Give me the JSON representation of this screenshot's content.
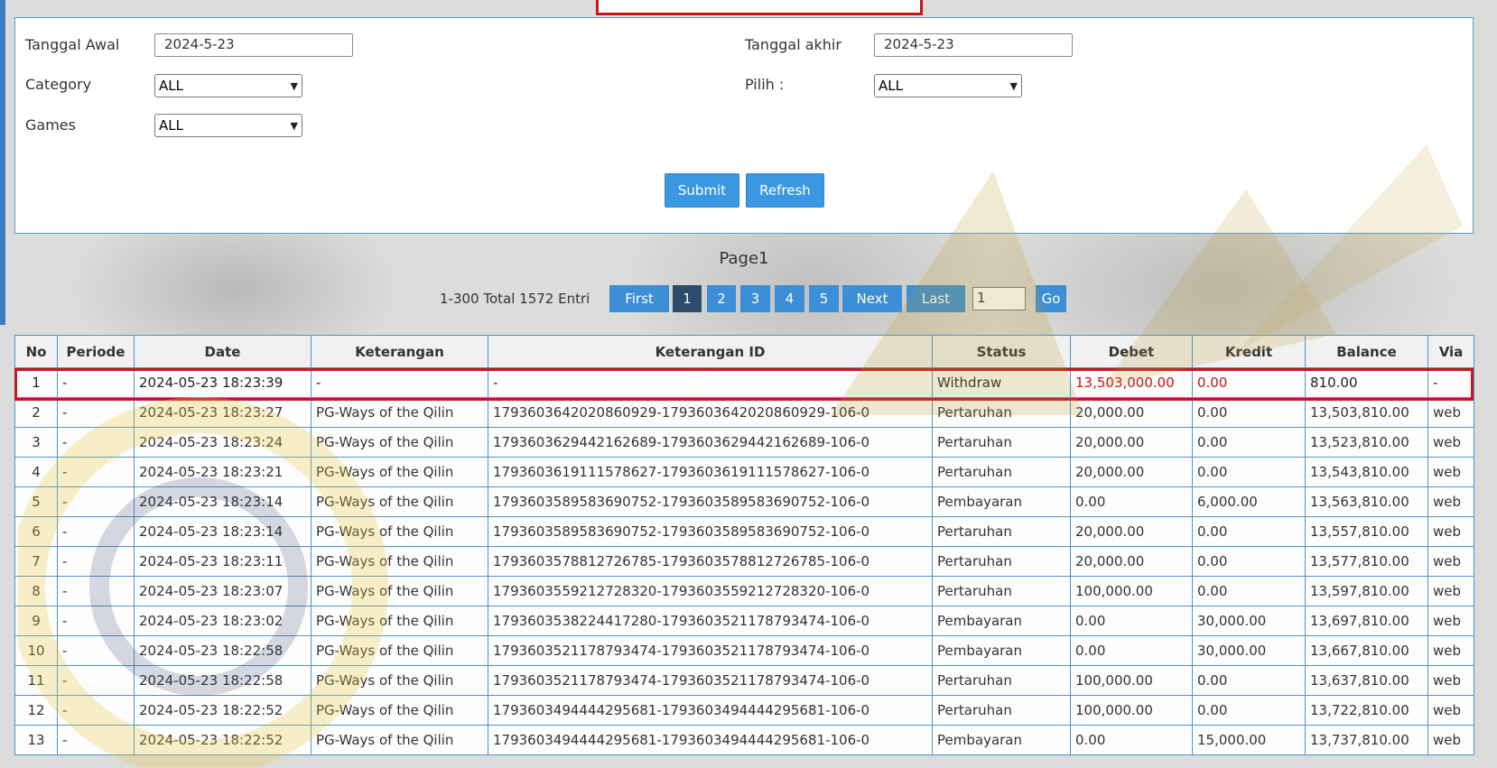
{
  "filters": {
    "tanggal_awal_label": "Tanggal Awal",
    "tanggal_awal_value": "2024-5-23",
    "tanggal_akhir_label": "Tanggal akhir",
    "tanggal_akhir_value": "2024-5-23",
    "category_label": "Category",
    "category_value": "ALL",
    "pilih_label": "Pilih :",
    "pilih_value": "ALL",
    "games_label": "Games",
    "games_value": "ALL",
    "submit_label": "Submit",
    "refresh_label": "Refresh"
  },
  "page_title": "Page1",
  "pager": {
    "info": "1-300 Total 1572 Entri",
    "first": "First",
    "pages": [
      "1",
      "2",
      "3",
      "4",
      "5"
    ],
    "next": "Next",
    "last": "Last",
    "goto_value": "1",
    "go": "Go"
  },
  "table": {
    "headers": [
      "No",
      "Periode",
      "Date",
      "Keterangan",
      "Keterangan ID",
      "Status",
      "Debet",
      "Kredit",
      "Balance",
      "Via"
    ],
    "rows": [
      [
        "1",
        "-",
        "2024-05-23 18:23:39",
        "-",
        "-",
        "Withdraw",
        "13,503,000.00",
        "0.00",
        "810.00",
        "-"
      ],
      [
        "2",
        "-",
        "2024-05-23 18:23:27",
        "PG-Ways of the Qilin",
        "1793603642020860929-1793603642020860929-106-0",
        "Pertaruhan",
        "20,000.00",
        "0.00",
        "13,503,810.00",
        "web"
      ],
      [
        "3",
        "-",
        "2024-05-23 18:23:24",
        "PG-Ways of the Qilin",
        "1793603629442162689-1793603629442162689-106-0",
        "Pertaruhan",
        "20,000.00",
        "0.00",
        "13,523,810.00",
        "web"
      ],
      [
        "4",
        "-",
        "2024-05-23 18:23:21",
        "PG-Ways of the Qilin",
        "1793603619111578627-1793603619111578627-106-0",
        "Pertaruhan",
        "20,000.00",
        "0.00",
        "13,543,810.00",
        "web"
      ],
      [
        "5",
        "-",
        "2024-05-23 18:23:14",
        "PG-Ways of the Qilin",
        "1793603589583690752-1793603589583690752-106-0",
        "Pembayaran",
        "0.00",
        "6,000.00",
        "13,563,810.00",
        "web"
      ],
      [
        "6",
        "-",
        "2024-05-23 18:23:14",
        "PG-Ways of the Qilin",
        "1793603589583690752-1793603589583690752-106-0",
        "Pertaruhan",
        "20,000.00",
        "0.00",
        "13,557,810.00",
        "web"
      ],
      [
        "7",
        "-",
        "2024-05-23 18:23:11",
        "PG-Ways of the Qilin",
        "1793603578812726785-1793603578812726785-106-0",
        "Pertaruhan",
        "20,000.00",
        "0.00",
        "13,577,810.00",
        "web"
      ],
      [
        "8",
        "-",
        "2024-05-23 18:23:07",
        "PG-Ways of the Qilin",
        "1793603559212728320-1793603559212728320-106-0",
        "Pertaruhan",
        "100,000.00",
        "0.00",
        "13,597,810.00",
        "web"
      ],
      [
        "9",
        "-",
        "2024-05-23 18:23:02",
        "PG-Ways of the Qilin",
        "1793603538224417280-1793603521178793474-106-0",
        "Pembayaran",
        "0.00",
        "30,000.00",
        "13,697,810.00",
        "web"
      ],
      [
        "10",
        "-",
        "2024-05-23 18:22:58",
        "PG-Ways of the Qilin",
        "1793603521178793474-1793603521178793474-106-0",
        "Pembayaran",
        "0.00",
        "30,000.00",
        "13,667,810.00",
        "web"
      ],
      [
        "11",
        "-",
        "2024-05-23 18:22:58",
        "PG-Ways of the Qilin",
        "1793603521178793474-1793603521178793474-106-0",
        "Pertaruhan",
        "100,000.00",
        "0.00",
        "13,637,810.00",
        "web"
      ],
      [
        "12",
        "-",
        "2024-05-23 18:22:52",
        "PG-Ways of the Qilin",
        "1793603494444295681-1793603494444295681-106-0",
        "Pertaruhan",
        "100,000.00",
        "0.00",
        "13,722,810.00",
        "web"
      ],
      [
        "13",
        "-",
        "2024-05-23 18:22:52",
        "PG-Ways of the Qilin",
        "1793603494444295681-1793603494444295681-106-0",
        "Pembayaran",
        "0.00",
        "15,000.00",
        "13,737,810.00",
        "web"
      ]
    ]
  },
  "colors": {
    "accent": "#3c97e2",
    "highlight_border": "#c8151b",
    "debit_highlight": "#c8151b"
  }
}
